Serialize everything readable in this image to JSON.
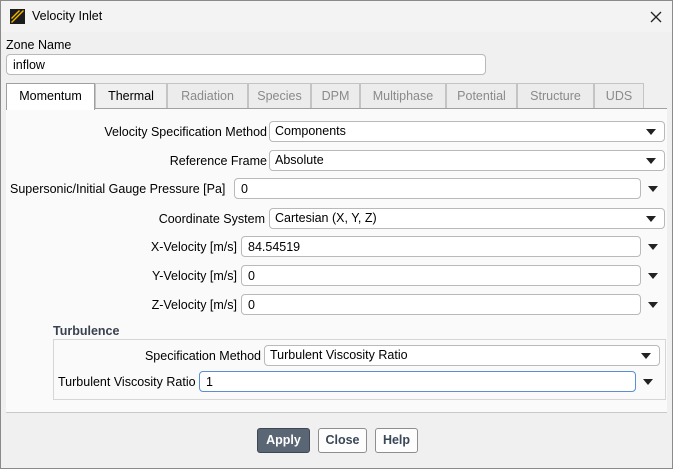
{
  "window": {
    "title": "Velocity Inlet",
    "app_icon": "fluent-app-icon",
    "close_icon": "close-icon"
  },
  "zone": {
    "label": "Zone Name",
    "value": "inflow"
  },
  "tabs": [
    {
      "label": "Momentum",
      "state": "active"
    },
    {
      "label": "Thermal",
      "state": "enabled"
    },
    {
      "label": "Radiation",
      "state": "disabled"
    },
    {
      "label": "Species",
      "state": "disabled"
    },
    {
      "label": "DPM",
      "state": "disabled"
    },
    {
      "label": "Multiphase",
      "state": "disabled"
    },
    {
      "label": "Potential",
      "state": "disabled"
    },
    {
      "label": "Structure",
      "state": "disabled"
    },
    {
      "label": "UDS",
      "state": "disabled"
    }
  ],
  "momentum": {
    "velocity_spec": {
      "label": "Velocity Specification Method",
      "value": "Components"
    },
    "reference_frame": {
      "label": "Reference Frame",
      "value": "Absolute"
    },
    "gauge_pressure": {
      "label": "Supersonic/Initial Gauge Pressure [Pa]",
      "value": "0"
    },
    "coordinate_system": {
      "label": "Coordinate System",
      "value": "Cartesian (X, Y, Z)"
    },
    "x_velocity": {
      "label": "X-Velocity [m/s]",
      "value": "84.54519"
    },
    "y_velocity": {
      "label": "Y-Velocity [m/s]",
      "value": "0"
    },
    "z_velocity": {
      "label": "Z-Velocity [m/s]",
      "value": "0"
    }
  },
  "turbulence": {
    "heading": "Turbulence",
    "spec_method": {
      "label": "Specification Method",
      "value": "Turbulent Viscosity Ratio"
    },
    "viscosity_ratio": {
      "label": "Turbulent Viscosity Ratio",
      "value": "1"
    }
  },
  "buttons": {
    "apply": "Apply",
    "close": "Close",
    "help": "Help"
  },
  "colors": {
    "primary_button": "#5b6675",
    "accent_text": "#3a4757"
  }
}
